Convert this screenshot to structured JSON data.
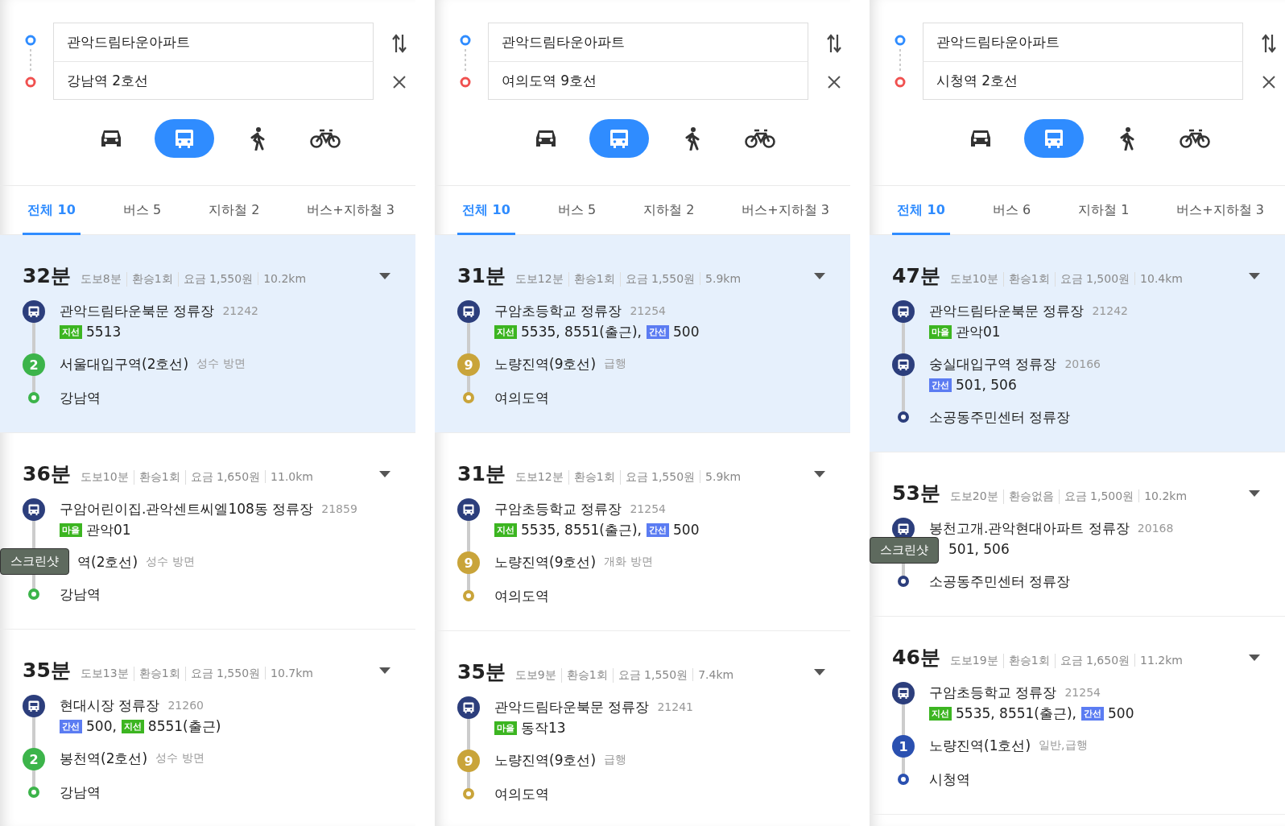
{
  "panels": [
    {
      "origin": "관악드림타운아파트",
      "destination": "강남역 2호선",
      "modes": [
        {
          "kind": "car",
          "selected": false
        },
        {
          "kind": "bus",
          "selected": true
        },
        {
          "kind": "walk",
          "selected": false
        },
        {
          "kind": "bike",
          "selected": false
        }
      ],
      "tabs": [
        {
          "label": "전체 10",
          "selected": true
        },
        {
          "label": "버스 5",
          "selected": false
        },
        {
          "label": "지하철 2",
          "selected": false
        },
        {
          "label": "버스+지하철 3",
          "selected": false
        }
      ],
      "routes": [
        {
          "selected": true,
          "time": "32분",
          "meta": [
            "도보8분",
            "환승1회",
            "요금 1,550원",
            "10.2km"
          ],
          "steps": [
            {
              "kind": "bus",
              "stop": "관악드림타운북문 정류장",
              "stop_id": "21242",
              "lines": [
                {
                  "type": "지선",
                  "color": "#3cb521",
                  "numbers": "5513"
                }
              ]
            },
            {
              "kind": "subway",
              "line": "2",
              "color": "#3cb44a",
              "name": "서울대입구역(2호선)",
              "direction": "성수 방면"
            },
            {
              "kind": "end",
              "color": "#3cb44a",
              "name": "강남역"
            }
          ]
        },
        {
          "selected": false,
          "time": "36분",
          "meta": [
            "도보10분",
            "환승1회",
            "요금 1,650원",
            "11.0km"
          ],
          "steps": [
            {
              "kind": "bus",
              "stop": "구암어린이집.관악센트씨엘108동 정류장",
              "stop_id": "21859",
              "lines": [
                {
                  "type": "마을",
                  "color": "#3cb521",
                  "numbers": "관악01"
                }
              ]
            },
            {
              "kind": "subway",
              "name": "역(2호선)",
              "direction": "성수 방면",
              "tooltip": "스크린샷"
            },
            {
              "kind": "end",
              "color": "#3cb44a",
              "name": "강남역"
            }
          ]
        },
        {
          "selected": false,
          "time": "35분",
          "meta": [
            "도보13분",
            "환승1회",
            "요금 1,550원",
            "10.7km"
          ],
          "steps": [
            {
              "kind": "bus",
              "stop": "현대시장 정류장",
              "stop_id": "21260",
              "lines": [
                {
                  "type": "간선",
                  "color": "#5b7cf2",
                  "numbers": "500,"
                },
                {
                  "type": "지선",
                  "color": "#3cb521",
                  "numbers": "8551(출근)"
                }
              ]
            },
            {
              "kind": "subway",
              "line": "2",
              "color": "#3cb44a",
              "name": "봉천역(2호선)",
              "direction": "성수 방면"
            },
            {
              "kind": "end",
              "color": "#3cb44a",
              "name": "강남역"
            }
          ]
        }
      ]
    },
    {
      "origin": "관악드림타운아파트",
      "destination": "여의도역 9호선",
      "modes": [
        {
          "kind": "car",
          "selected": false
        },
        {
          "kind": "bus",
          "selected": true
        },
        {
          "kind": "walk",
          "selected": false
        },
        {
          "kind": "bike",
          "selected": false
        }
      ],
      "tabs": [
        {
          "label": "전체 10",
          "selected": true
        },
        {
          "label": "버스 5",
          "selected": false
        },
        {
          "label": "지하철 2",
          "selected": false
        },
        {
          "label": "버스+지하철 3",
          "selected": false
        }
      ],
      "routes": [
        {
          "selected": true,
          "time": "31분",
          "meta": [
            "도보12분",
            "환승1회",
            "요금 1,550원",
            "5.9km"
          ],
          "steps": [
            {
              "kind": "bus",
              "stop": "구암초등학교 정류장",
              "stop_id": "21254",
              "lines": [
                {
                  "type": "지선",
                  "color": "#3cb521",
                  "numbers": "5535, 8551(출근),"
                },
                {
                  "type": "간선",
                  "color": "#5b7cf2",
                  "numbers": "500"
                }
              ]
            },
            {
              "kind": "subway",
              "line": "9",
              "color": "#c9a43a",
              "name": "노량진역(9호선)",
              "direction": "급행"
            },
            {
              "kind": "end",
              "color": "#c9a43a",
              "name": "여의도역"
            }
          ]
        },
        {
          "selected": false,
          "time": "31분",
          "meta": [
            "도보12분",
            "환승1회",
            "요금 1,550원",
            "5.9km"
          ],
          "steps": [
            {
              "kind": "bus",
              "stop": "구암초등학교 정류장",
              "stop_id": "21254",
              "lines": [
                {
                  "type": "지선",
                  "color": "#3cb521",
                  "numbers": "5535, 8551(출근),"
                },
                {
                  "type": "간선",
                  "color": "#5b7cf2",
                  "numbers": "500"
                }
              ]
            },
            {
              "kind": "subway",
              "line": "9",
              "color": "#c9a43a",
              "name": "노량진역(9호선)",
              "direction": "개화 방면"
            },
            {
              "kind": "end",
              "color": "#c9a43a",
              "name": "여의도역"
            }
          ]
        },
        {
          "selected": false,
          "time": "35분",
          "meta": [
            "도보9분",
            "환승1회",
            "요금 1,550원",
            "7.4km"
          ],
          "steps": [
            {
              "kind": "bus",
              "stop": "관악드림타운북문 정류장",
              "stop_id": "21241",
              "lines": [
                {
                  "type": "마을",
                  "color": "#3cb521",
                  "numbers": "동작13"
                }
              ]
            },
            {
              "kind": "subway",
              "line": "9",
              "color": "#c9a43a",
              "name": "노량진역(9호선)",
              "direction": "급행"
            },
            {
              "kind": "end",
              "color": "#c9a43a",
              "name": "여의도역"
            }
          ]
        }
      ]
    },
    {
      "origin": "관악드림타운아파트",
      "destination": "시청역 2호선",
      "modes": [
        {
          "kind": "car",
          "selected": false
        },
        {
          "kind": "bus",
          "selected": true
        },
        {
          "kind": "walk",
          "selected": false
        },
        {
          "kind": "bike",
          "selected": false
        }
      ],
      "tabs": [
        {
          "label": "전체 10",
          "selected": true
        },
        {
          "label": "버스 6",
          "selected": false
        },
        {
          "label": "지하철 1",
          "selected": false
        },
        {
          "label": "버스+지하철 3",
          "selected": false
        }
      ],
      "routes": [
        {
          "selected": true,
          "time": "47분",
          "meta": [
            "도보10분",
            "환승1회",
            "요금 1,500원",
            "10.4km"
          ],
          "steps": [
            {
              "kind": "bus",
              "stop": "관악드림타운북문 정류장",
              "stop_id": "21242",
              "lines": [
                {
                  "type": "마을",
                  "color": "#3cb521",
                  "numbers": "관악01"
                }
              ]
            },
            {
              "kind": "bus",
              "stop": "숭실대입구역 정류장",
              "stop_id": "20166",
              "lines": [
                {
                  "type": "간선",
                  "color": "#5b7cf2",
                  "numbers": "501, 506"
                }
              ]
            },
            {
              "kind": "end",
              "color": "#2c3e7c",
              "name": "소공동주민센터 정류장"
            }
          ]
        },
        {
          "selected": false,
          "time": "53분",
          "meta": [
            "도보20분",
            "환승없음",
            "요금 1,500원",
            "10.2km"
          ],
          "steps": [
            {
              "kind": "bus",
              "stop": "봉천고개.관악현대아파트 정류장",
              "stop_id": "20168",
              "lines": [
                {
                  "numbers": "501, 506"
                }
              ],
              "tooltip": "스크린샷"
            },
            {
              "kind": "end",
              "color": "#2c3e7c",
              "name": "소공동주민센터 정류장"
            }
          ]
        },
        {
          "selected": false,
          "time": "46분",
          "meta": [
            "도보19분",
            "환승1회",
            "요금 1,650원",
            "11.2km"
          ],
          "steps": [
            {
              "kind": "bus",
              "stop": "구암초등학교 정류장",
              "stop_id": "21254",
              "lines": [
                {
                  "type": "지선",
                  "color": "#3cb521",
                  "numbers": "5535, 8551(출근),"
                },
                {
                  "type": "간선",
                  "color": "#5b7cf2",
                  "numbers": "500"
                }
              ]
            },
            {
              "kind": "subway",
              "line": "1",
              "color": "#2a50b0",
              "name": "노량진역(1호선)",
              "direction": "일반,급행"
            },
            {
              "kind": "end",
              "color": "#2a50b0",
              "name": "시청역"
            }
          ]
        }
      ]
    }
  ]
}
